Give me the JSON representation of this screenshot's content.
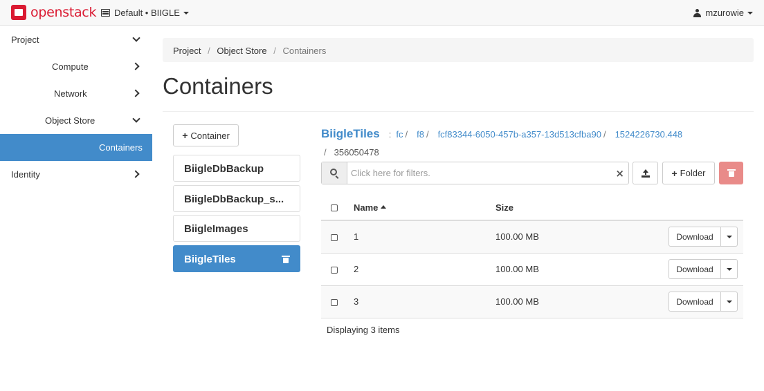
{
  "topbar": {
    "brand": "openstack",
    "project": "Default • BIIGLE",
    "user": "mzurowie"
  },
  "sidebar": {
    "items": [
      {
        "label": "Project",
        "level": 0,
        "chevron": "down"
      },
      {
        "label": "Compute",
        "level": 2,
        "chevron": "right"
      },
      {
        "label": "Network",
        "level": 2,
        "chevron": "right"
      },
      {
        "label": "Object Store",
        "level": 1,
        "chevron": "down"
      },
      {
        "label": "Containers",
        "level": 3,
        "active": true
      },
      {
        "label": "Identity",
        "level": 0,
        "chevron": "right"
      }
    ]
  },
  "breadcrumb": {
    "items": [
      "Project",
      "Object Store",
      "Containers"
    ]
  },
  "page_title": "Containers",
  "containers": {
    "add_label": "Container",
    "items": [
      {
        "name": "BiigleDbBackup"
      },
      {
        "name": "BiigleDbBackup_s..."
      },
      {
        "name": "BiigleImages"
      },
      {
        "name": "BiigleTiles",
        "active": true
      }
    ]
  },
  "object_path": {
    "root": "BiigleTiles",
    "segments": [
      "fc",
      "f8",
      "fcf83344-6050-457b-a357-13d513cfba90",
      "1524226730.448"
    ],
    "last": "356050478"
  },
  "toolbar": {
    "filter_placeholder": "Click here for filters.",
    "folder_label": "Folder",
    "colors": {
      "danger": "#e98b89",
      "primary": "#428bca"
    }
  },
  "table": {
    "headers": {
      "name": "Name",
      "size": "Size"
    },
    "rows": [
      {
        "name": "1",
        "size": "100.00 MB",
        "action": "Download"
      },
      {
        "name": "2",
        "size": "100.00 MB",
        "action": "Download"
      },
      {
        "name": "3",
        "size": "100.00 MB",
        "action": "Download"
      }
    ],
    "footer": "Displaying 3 items"
  }
}
